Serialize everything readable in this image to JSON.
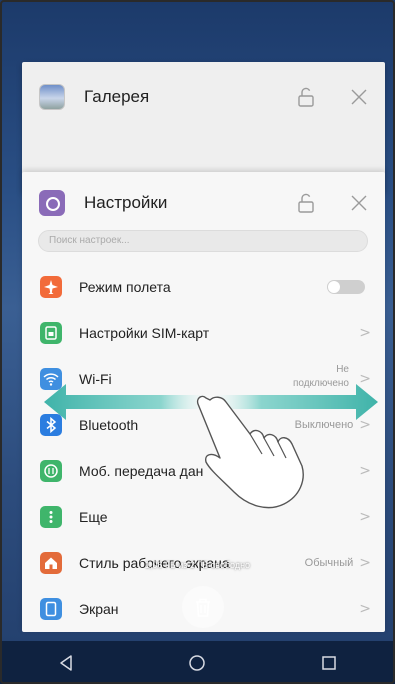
{
  "recent_apps": [
    {
      "title": "Галерея",
      "icon": "gallery-icon"
    },
    {
      "title": "Настройки",
      "icon": "settings-icon"
    }
  ],
  "settings": {
    "search_placeholder": "Поиск настроек...",
    "items": [
      {
        "label": "Режим полета",
        "icon": "airplane-icon",
        "color": "#f26b3a",
        "value": "",
        "control": "toggle",
        "toggle_state": "off"
      },
      {
        "label": "Настройки SIM-карт",
        "icon": "sim-card-icon",
        "color": "#3fb56b",
        "value": "",
        "control": "chevron"
      },
      {
        "label": "Wi-Fi",
        "icon": "wifi-icon",
        "color": "#3f8fe0",
        "value_line1": "Не",
        "value_line2": "подключено",
        "control": "chevron"
      },
      {
        "label": "Bluetooth",
        "icon": "bluetooth-icon",
        "color": "#2b7de0",
        "value": "Выключено",
        "control": "chevron"
      },
      {
        "label": "Моб. передача дан",
        "icon": "mobile-data-icon",
        "color": "#3fb56b",
        "value": "",
        "control": "chevron"
      },
      {
        "label": "Еще",
        "icon": "more-icon",
        "color": "#3fb56b",
        "value": "",
        "control": "chevron"
      },
      {
        "label": "Стиль рабочего экрана",
        "icon": "home-style-icon",
        "color": "#e36b3a",
        "value": "Обычный",
        "control": "chevron"
      },
      {
        "label": "Экран",
        "icon": "display-icon",
        "color": "#3f8fe0",
        "value": "",
        "control": "chevron"
      }
    ]
  },
  "storage_text": "1,06 ГБ из 2 ГБ свободно",
  "chevron_glyph": ">",
  "navbar": [
    "back-icon",
    "home-icon",
    "recents-icon"
  ],
  "colors": {
    "accent": "#2a7ad9",
    "swipe_arrow": "#4fb8b0"
  }
}
